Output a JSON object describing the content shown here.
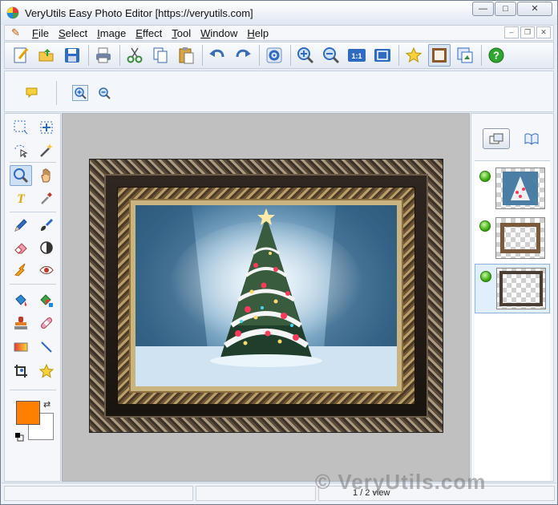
{
  "window": {
    "title": "VeryUtils Easy Photo Editor [https://veryutils.com]",
    "controls": {
      "minimize": "—",
      "maximize": "□",
      "close": "✕"
    }
  },
  "menu": {
    "items": [
      {
        "accel": "F",
        "rest": "ile"
      },
      {
        "accel": "S",
        "rest": "elect"
      },
      {
        "accel": "I",
        "rest": "mage"
      },
      {
        "accel": "E",
        "rest": "ffect"
      },
      {
        "accel": "T",
        "rest": "ool"
      },
      {
        "accel": "W",
        "rest": "indow"
      },
      {
        "accel": "H",
        "rest": "elp"
      }
    ],
    "mdi_controls": {
      "minimize": "–",
      "restore": "❐",
      "close": "✕"
    }
  },
  "toolbar": {
    "icons": [
      "new-icon",
      "open-icon",
      "save-icon",
      "print-icon",
      "cut-icon",
      "copy-icon",
      "paste-icon",
      "undo-icon",
      "redo-icon",
      "settings-icon",
      "zoom-in-icon",
      "zoom-out-icon",
      "actual-size-icon",
      "fit-window-icon",
      "favorite-icon",
      "frame-icon",
      "layer-export-icon",
      "help-icon"
    ],
    "actual_size_label": "1:1"
  },
  "tools": {
    "colors": {
      "foreground": "#ff7f00",
      "background": "#ffffff"
    },
    "swap_glyph": "⇄"
  },
  "status": {
    "cells": [
      "",
      "",
      "1 / 2 view"
    ]
  },
  "watermark": "© VeryUtils.com",
  "colors": {
    "accent_blue": "#3a6fb5",
    "layer_visible": "#3fae10"
  }
}
